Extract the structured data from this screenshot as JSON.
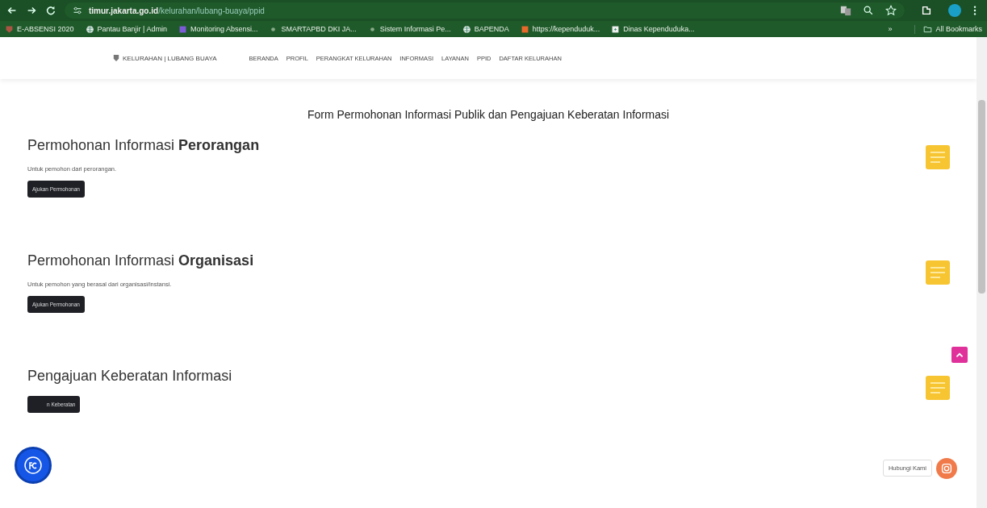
{
  "browser": {
    "url_host": "timur.jakarta.go.id",
    "url_path": "/kelurahan/lubang-buaya/ppid",
    "bookmarks": [
      {
        "label": "E-ABSENSI 2020",
        "kind": "shield"
      },
      {
        "label": "Pantau Banjir | Admin",
        "kind": "globe"
      },
      {
        "label": "Monitoring Absensi...",
        "kind": "square"
      },
      {
        "label": "SMARTAPBD DKI JA...",
        "kind": "dot"
      },
      {
        "label": "Sistem Informasi Pe...",
        "kind": "dot"
      },
      {
        "label": "BAPENDA",
        "kind": "globe"
      },
      {
        "label": "https://kependuduk...",
        "kind": "orange"
      },
      {
        "label": "Dinas Kependuduka...",
        "kind": "white"
      }
    ],
    "more": "»",
    "all_bookmarks": "All Bookmarks"
  },
  "site": {
    "brand": "KELURAHAN | LUBANG BUAYA",
    "nav": [
      "BERANDA",
      "PROFIL",
      "PERANGKAT KELURAHAN",
      "INFORMASI",
      "LAYANAN",
      "PPID",
      "DAFTAR KELURAHAN"
    ]
  },
  "page_title": "Form Permohonan Informasi Publik dan Pengajuan Keberatan Informasi",
  "sections": [
    {
      "title": "Permohonan Informasi **Perorangan**",
      "description": "Untuk pemohon dari perorangan.",
      "button": "Ajukan Permohonan"
    },
    {
      "title": "Permohonan Informasi **Organisasi**",
      "description": "Untuk pemohon yang berasal dari organisasi/instansi.",
      "button": "Ajukan Permohonan"
    },
    {
      "title": "Pengajuan Keberatan Informasi",
      "button": "n Keberatan"
    }
  ],
  "contact_label": "Hubungi Kami"
}
